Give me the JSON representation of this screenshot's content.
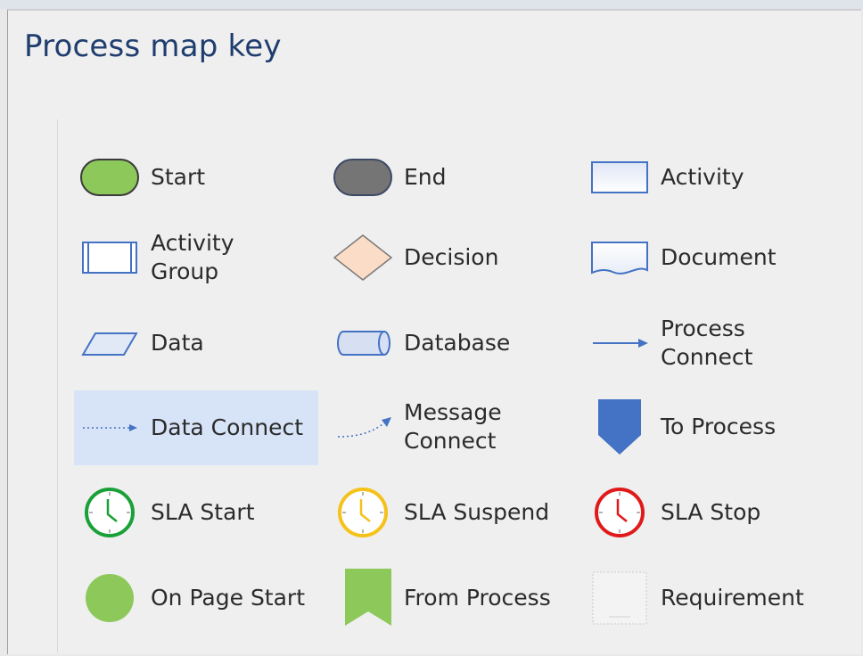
{
  "title": "Process map key",
  "colors": {
    "blue": "#4472c4",
    "green": "#8dc85b",
    "gray": "#757575",
    "highlight": "#d7e3f7",
    "sla_start": "#1aa038",
    "sla_suspend": "#f4c21a",
    "sla_stop": "#e01a1a"
  },
  "legend": {
    "start": {
      "label": "Start",
      "icon": "start-terminator-icon"
    },
    "end": {
      "label": "End",
      "icon": "end-terminator-icon"
    },
    "activity": {
      "label": "Activity",
      "icon": "activity-rectangle-icon"
    },
    "activity_group": {
      "label1": "Activity",
      "label2": "Group",
      "icon": "activity-group-icon"
    },
    "decision": {
      "label": "Decision",
      "icon": "decision-diamond-icon"
    },
    "document": {
      "label": "Document",
      "icon": "document-icon"
    },
    "data": {
      "label": "Data",
      "icon": "data-parallelogram-icon"
    },
    "database": {
      "label": "Database",
      "icon": "database-cylinder-icon"
    },
    "process_connect": {
      "label1": "Process",
      "label2": "Connect",
      "icon": "process-connect-arrow-icon"
    },
    "data_connect": {
      "label": "Data Connect",
      "icon": "data-connect-arrow-icon"
    },
    "message_connect": {
      "label1": "Message",
      "label2": "Connect",
      "icon": "message-connect-arrow-icon"
    },
    "to_process": {
      "label": "To Process",
      "icon": "to-process-pentagon-icon"
    },
    "sla_start": {
      "label": "SLA Start",
      "icon": "sla-start-clock-icon"
    },
    "sla_suspend": {
      "label": "SLA Suspend",
      "icon": "sla-suspend-clock-icon"
    },
    "sla_stop": {
      "label": "SLA Stop",
      "icon": "sla-stop-clock-icon"
    },
    "on_page_start": {
      "label": "On Page Start",
      "icon": "on-page-start-circle-icon"
    },
    "from_process": {
      "label": "From Process",
      "icon": "from-process-banner-icon"
    },
    "requirement": {
      "label": "Requirement",
      "icon": "requirement-icon"
    }
  }
}
